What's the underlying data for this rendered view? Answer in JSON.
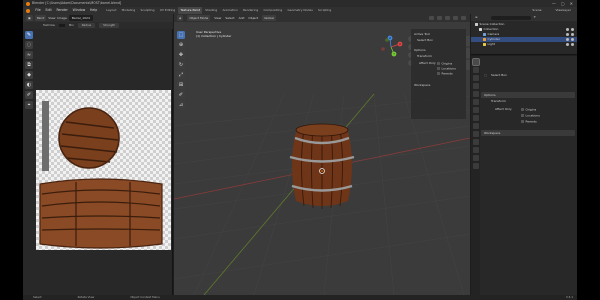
{
  "window": {
    "title": "Blender [C:\\Users\\Adam\\Documents\\MOST\\barrel.blend]",
    "controls": [
      "—",
      "▢",
      "✕"
    ]
  },
  "menubar": {
    "menus": [
      "File",
      "Edit",
      "Render",
      "Window",
      "Help"
    ],
    "workspaces": [
      "Layout",
      "Modeling",
      "Sculpting",
      "UV Editing",
      "Texture Paint",
      "Shading",
      "Animation",
      "Rendering",
      "Compositing",
      "Geometry Nodes",
      "Scripting"
    ],
    "active_workspace": "Texture Paint",
    "scene": "Scene",
    "view_layer": "ViewLayer"
  },
  "image_editor": {
    "header": {
      "mode": "Paint",
      "view": "View",
      "image": "Image",
      "image_name": "Barrel_1024"
    },
    "toolsettings": {
      "brush": "TexDraw",
      "blend": "Mix",
      "radius": "Radius",
      "strength": "Strength"
    }
  },
  "viewport": {
    "header": {
      "editor": "Object Mode",
      "menus": [
        "View",
        "Select",
        "Add",
        "Object"
      ],
      "orientation": "Global",
      "options": "Options"
    },
    "info_line1": "User Perspective",
    "info_line2": "(1) Collection | Cylinder",
    "gizmo_axes": [
      "X",
      "Y",
      "Z"
    ],
    "sidebar": {
      "active_tool": "Active Tool",
      "tool_name": "Select Box",
      "options": "Options",
      "transform": "Transform",
      "affect_only": "Affect Only",
      "origins": "Origins",
      "locations": "Locations",
      "parents": "Parents",
      "workspace": "Workspace"
    }
  },
  "outliner": {
    "root": "Scene Collection",
    "items": [
      {
        "name": "Collection",
        "color": "#d9d9d9"
      },
      {
        "name": "Camera",
        "color": "#6fa0de"
      },
      {
        "name": "Cylinder",
        "color": "#e69d3b"
      },
      {
        "name": "Light",
        "color": "#e6c84a"
      }
    ]
  },
  "properties": {
    "tool_name": "Select Box",
    "options": "Options",
    "transform": "Transform",
    "affect_only": "Affect Only",
    "origins": "Origins",
    "locations": "Locations",
    "parents": "Parents",
    "workspace": "Workspace"
  },
  "statusbar": {
    "select": "Select",
    "rotate_view": "Rotate View",
    "context_menu": "Object Context Menu",
    "version": "3.3.1"
  },
  "colors": {
    "accent": "#4772b3",
    "blender_orange": "#e87d0d",
    "wood": "#8a4a25",
    "wood_dark": "#3a1d0c",
    "metal": "#8e8e8e",
    "grid_red": "#8a3a3a",
    "grid_green": "#5e7a2c"
  }
}
